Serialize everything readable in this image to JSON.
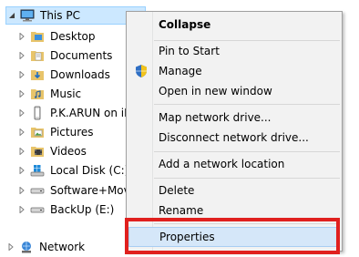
{
  "tree": {
    "items": [
      {
        "label": "This PC"
      },
      {
        "label": "Desktop"
      },
      {
        "label": "Documents"
      },
      {
        "label": "Downloads"
      },
      {
        "label": "Music"
      },
      {
        "label": "P.K.ARUN on iPh"
      },
      {
        "label": "Pictures"
      },
      {
        "label": "Videos"
      },
      {
        "label": "Local Disk (C:)"
      },
      {
        "label": "Software+Movie"
      },
      {
        "label": "BackUp (E:)"
      },
      {
        "label": "Network"
      }
    ]
  },
  "context_menu": {
    "items": [
      {
        "label": "Collapse"
      },
      {
        "label": "Pin to Start"
      },
      {
        "label": "Manage"
      },
      {
        "label": "Open in new window"
      },
      {
        "label": "Map network drive..."
      },
      {
        "label": "Disconnect network drive..."
      },
      {
        "label": "Add a network location"
      },
      {
        "label": "Delete"
      },
      {
        "label": "Rename"
      },
      {
        "label": "Properties"
      }
    ]
  },
  "colors": {
    "selection": "#cce8ff",
    "menu_hover": "#d5e7f9",
    "highlight_box": "#e0201e"
  }
}
